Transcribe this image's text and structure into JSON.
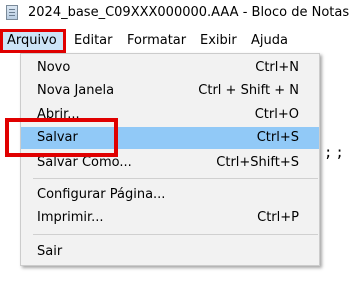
{
  "window": {
    "title": "2024_base_C09XXX000000.AAA - Bloco de Notas",
    "icon": "notepad-icon"
  },
  "menubar": {
    "items": [
      "Arquivo",
      "Editar",
      "Formatar",
      "Exibir",
      "Ajuda"
    ],
    "active": "Arquivo"
  },
  "file_menu": {
    "items": [
      {
        "label": "Novo",
        "shortcut": "Ctrl+N"
      },
      {
        "label": "Nova Janela",
        "shortcut": "Ctrl + Shift + N"
      },
      {
        "label": "Abrir...",
        "shortcut": "Ctrl+O"
      },
      {
        "label": "Salvar",
        "shortcut": "Ctrl+S",
        "highlighted": true
      },
      {
        "label": "Salvar Como...",
        "shortcut": "Ctrl+Shift+S"
      },
      {
        "label": "Configurar Página...",
        "shortcut": ""
      },
      {
        "label": "Imprimir...",
        "shortcut": "Ctrl+P"
      },
      {
        "label": "Sair",
        "shortcut": ""
      }
    ]
  },
  "editor": {
    "visible_fragment": ";;"
  },
  "colors": {
    "highlight": "#91c9f7",
    "annotation_red": "#e00000",
    "menu_bg": "#f2f2f2"
  }
}
